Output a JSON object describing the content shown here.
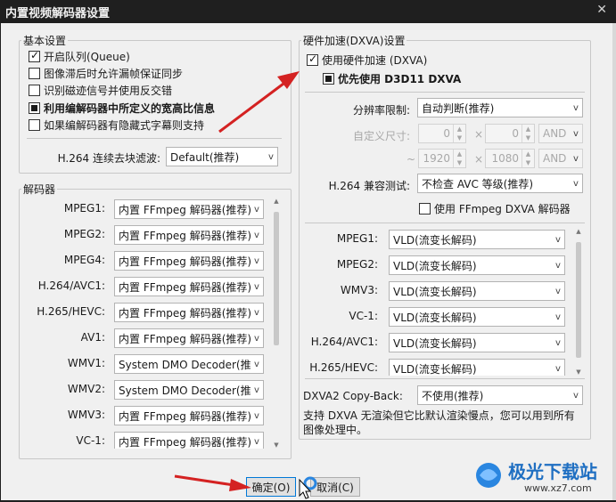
{
  "window": {
    "title": "内置视频解码器设置",
    "close_glyph": "✕"
  },
  "basic": {
    "legend": "基本设置",
    "options": [
      {
        "label": "开启队列(Queue)",
        "checked": true
      },
      {
        "label": "图像滞后时允许漏帧保证同步",
        "checked": false
      },
      {
        "label": "识别磁迹信号并使用反交错",
        "checked": false
      },
      {
        "label": "利用编解码器中所定义的宽高比信息",
        "state": "indeterminate"
      },
      {
        "label": "如果编解码器有隐藏式字幕则支持",
        "checked": false
      }
    ],
    "deblock_label": "H.264 连续去块滤波:",
    "deblock_value": "Default(推荐)"
  },
  "decoders": {
    "legend": "解码器",
    "rows": [
      {
        "label": "MPEG1:",
        "value": "内置 FFmpeg 解码器(推荐)"
      },
      {
        "label": "MPEG2:",
        "value": "内置 FFmpeg 解码器(推荐)"
      },
      {
        "label": "MPEG4:",
        "value": "内置 FFmpeg 解码器(推荐)"
      },
      {
        "label": "H.264/AVC1:",
        "value": "内置 FFmpeg 解码器(推荐)"
      },
      {
        "label": "H.265/HEVC:",
        "value": "内置 FFmpeg 解码器(推荐)"
      },
      {
        "label": "AV1:",
        "value": "内置 FFmpeg 解码器(推荐)"
      },
      {
        "label": "WMV1:",
        "value": "System DMO Decoder(推荐)"
      },
      {
        "label": "WMV2:",
        "value": "System DMO Decoder(推荐)"
      },
      {
        "label": "WMV3:",
        "value": "内置 FFmpeg 解码器(推荐)"
      },
      {
        "label": "VC-1:",
        "value": "内置 FFmpeg 解码器(推荐)"
      }
    ]
  },
  "hw": {
    "legend": "硬件加速(DXVA)设置",
    "use_hw_label": "使用硬件加速 (DXVA)",
    "prefer_d3d11_label": "优先使用 D3D11 DXVA",
    "resolution_label": "分辨率限制:",
    "resolution_value": "自动判断(推荐)",
    "custom_size_label": "自定义尺寸:",
    "min_w": "0",
    "min_h": "0",
    "max_w": "1920",
    "max_h": "1080",
    "and1": "AND",
    "and2": "AND",
    "times": "×",
    "tilde": "~",
    "compat_label": "H.264 兼容测试:",
    "compat_value": "不检查 AVC 等级(推荐)",
    "ffmpeg_dxva_label": "使用 FFmpeg DXVA 解码器",
    "rows": [
      {
        "label": "MPEG1:",
        "value": "VLD(流变长解码)"
      },
      {
        "label": "MPEG2:",
        "value": "VLD(流变长解码)"
      },
      {
        "label": "WMV3:",
        "value": "VLD(流变长解码)"
      },
      {
        "label": "VC-1:",
        "value": "VLD(流变长解码)"
      },
      {
        "label": "H.264/AVC1:",
        "value": "VLD(流变长解码)"
      },
      {
        "label": "H.265/HEVC:",
        "value": "VLD(流变长解码)"
      }
    ],
    "copyback_label": "DXVA2 Copy-Back:",
    "copyback_value": "不使用(推荐)",
    "info": "支持 DXVA 无渲染但它比默认渲染慢点，您可以用到所有图像处理中。"
  },
  "buttons": {
    "ok": "确定(O)",
    "cancel": "取消(C)"
  },
  "watermark": {
    "brand": "极光下载站",
    "url": "www.xz7.com"
  },
  "colors": {
    "arrow": "#d42222",
    "accent": "#0078d7",
    "titlebar": "#1f1f1f"
  }
}
